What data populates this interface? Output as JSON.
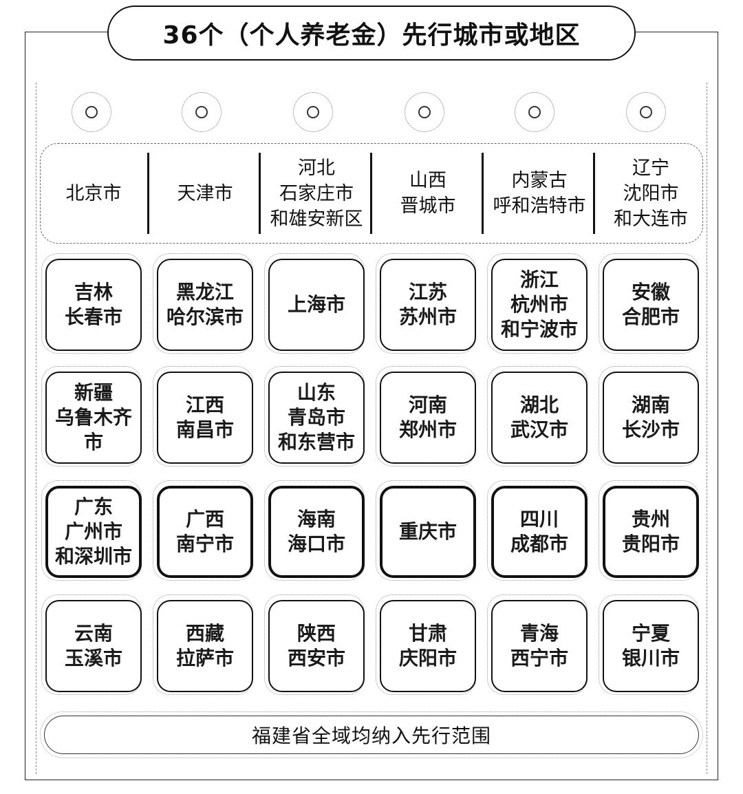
{
  "title": "36个（个人养老金）先行城市或地区",
  "top_row": [
    "北京市",
    "天津市",
    "河北\n石家庄市\n和雄安新区",
    "山西\n晋城市",
    "内蒙古\n呼和浩特市",
    "辽宁\n沈阳市\n和大连市"
  ],
  "grid": [
    [
      "吉林\n长春市",
      "黑龙江\n哈尔滨市",
      "上海市",
      "江苏\n苏州市",
      "浙江\n杭州市\n和宁波市",
      "安徽\n合肥市"
    ],
    [
      "新疆\n乌鲁木齐市",
      "江西\n南昌市",
      "山东\n青岛市\n和东营市",
      "河南\n郑州市",
      "湖北\n武汉市",
      "湖南\n长沙市"
    ],
    [
      "广东\n广州市\n和深圳市",
      "广西\n南宁市",
      "海南\n海口市",
      "重庆市",
      "四川\n成都市",
      "贵州\n贵阳市"
    ],
    [
      "云南\n玉溪市",
      "西藏\n拉萨市",
      "陕西\n西安市",
      "甘肃\n庆阳市",
      "青海\n西宁市",
      "宁夏\n银川市"
    ]
  ],
  "footer": "福建省全域均纳入先行范围"
}
